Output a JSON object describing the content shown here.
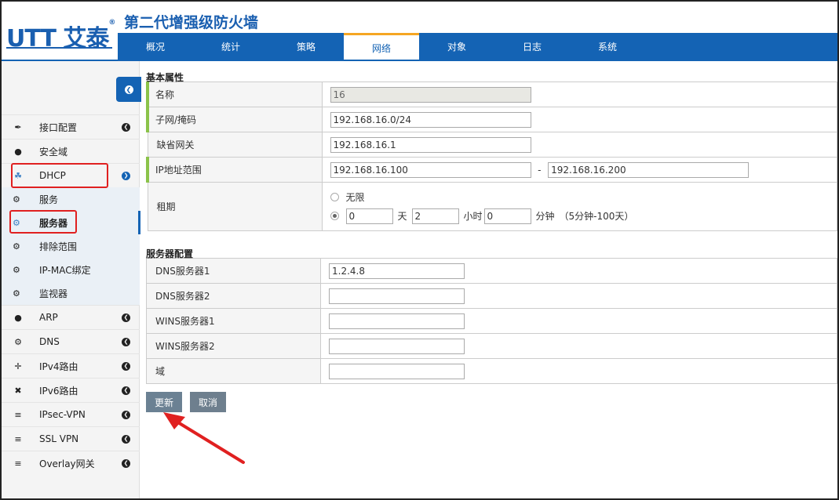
{
  "header": {
    "logo_text": "UTT 艾泰",
    "title": "第二代增强级防火墙",
    "tabs": [
      {
        "label": "概况"
      },
      {
        "label": "统计"
      },
      {
        "label": "策略"
      },
      {
        "label": "网络",
        "active": true
      },
      {
        "label": "对象"
      },
      {
        "label": "日志"
      },
      {
        "label": "系统"
      }
    ]
  },
  "sidebar": {
    "items": [
      {
        "label": "接口配置",
        "icon": "plug-icon"
      },
      {
        "label": "安全域",
        "icon": "globe-icon"
      },
      {
        "label": "DHCP",
        "icon": "network-icon",
        "open": true
      },
      {
        "label": "ARP",
        "icon": "globe-icon"
      },
      {
        "label": "DNS",
        "icon": "gears-icon"
      },
      {
        "label": "IPv4路由",
        "icon": "move-icon"
      },
      {
        "label": "IPv6路由",
        "icon": "expand-icon"
      },
      {
        "label": "IPsec-VPN",
        "icon": "list-icon"
      },
      {
        "label": "SSL VPN",
        "icon": "list-icon"
      },
      {
        "label": "Overlay网关",
        "icon": "list-icon"
      }
    ],
    "dhcp_sub": [
      {
        "label": "服务",
        "icon": "gear-icon"
      },
      {
        "label": "服务器",
        "icon": "gear-icon",
        "active": true
      },
      {
        "label": "排除范围",
        "icon": "gear-icon"
      },
      {
        "label": "IP-MAC绑定",
        "icon": "gear-icon"
      },
      {
        "label": "监视器",
        "icon": "gear-icon"
      }
    ]
  },
  "basic": {
    "section_title": "基本属性",
    "name_label": "名称",
    "name_value": "16",
    "subnet_label": "子网/掩码",
    "subnet_value": "192.168.16.0/24",
    "gateway_label": "缺省网关",
    "gateway_value": "192.168.16.1",
    "range_label": "IP地址范围",
    "range_start": "192.168.16.100",
    "range_sep": "-",
    "range_end": "192.168.16.200",
    "lease_label": "租期",
    "lease_unlimited": "无限",
    "lease_days": "0",
    "lease_days_unit": "天",
    "lease_hours": "2",
    "lease_hours_unit": "小时",
    "lease_minutes": "0",
    "lease_minutes_unit": "分钟",
    "lease_hint": "（5分钟-100天）"
  },
  "server": {
    "section_title": "服务器配置",
    "dns1_label": "DNS服务器1",
    "dns1_value": "1.2.4.8",
    "dns2_label": "DNS服务器2",
    "dns2_value": "",
    "wins1_label": "WINS服务器1",
    "wins1_value": "",
    "wins2_label": "WINS服务器2",
    "wins2_value": "",
    "domain_label": "域",
    "domain_value": ""
  },
  "actions": {
    "update_label": "更新",
    "cancel_label": "取消"
  },
  "annotation_color": "#e02020",
  "accent_color": "#1463b4"
}
